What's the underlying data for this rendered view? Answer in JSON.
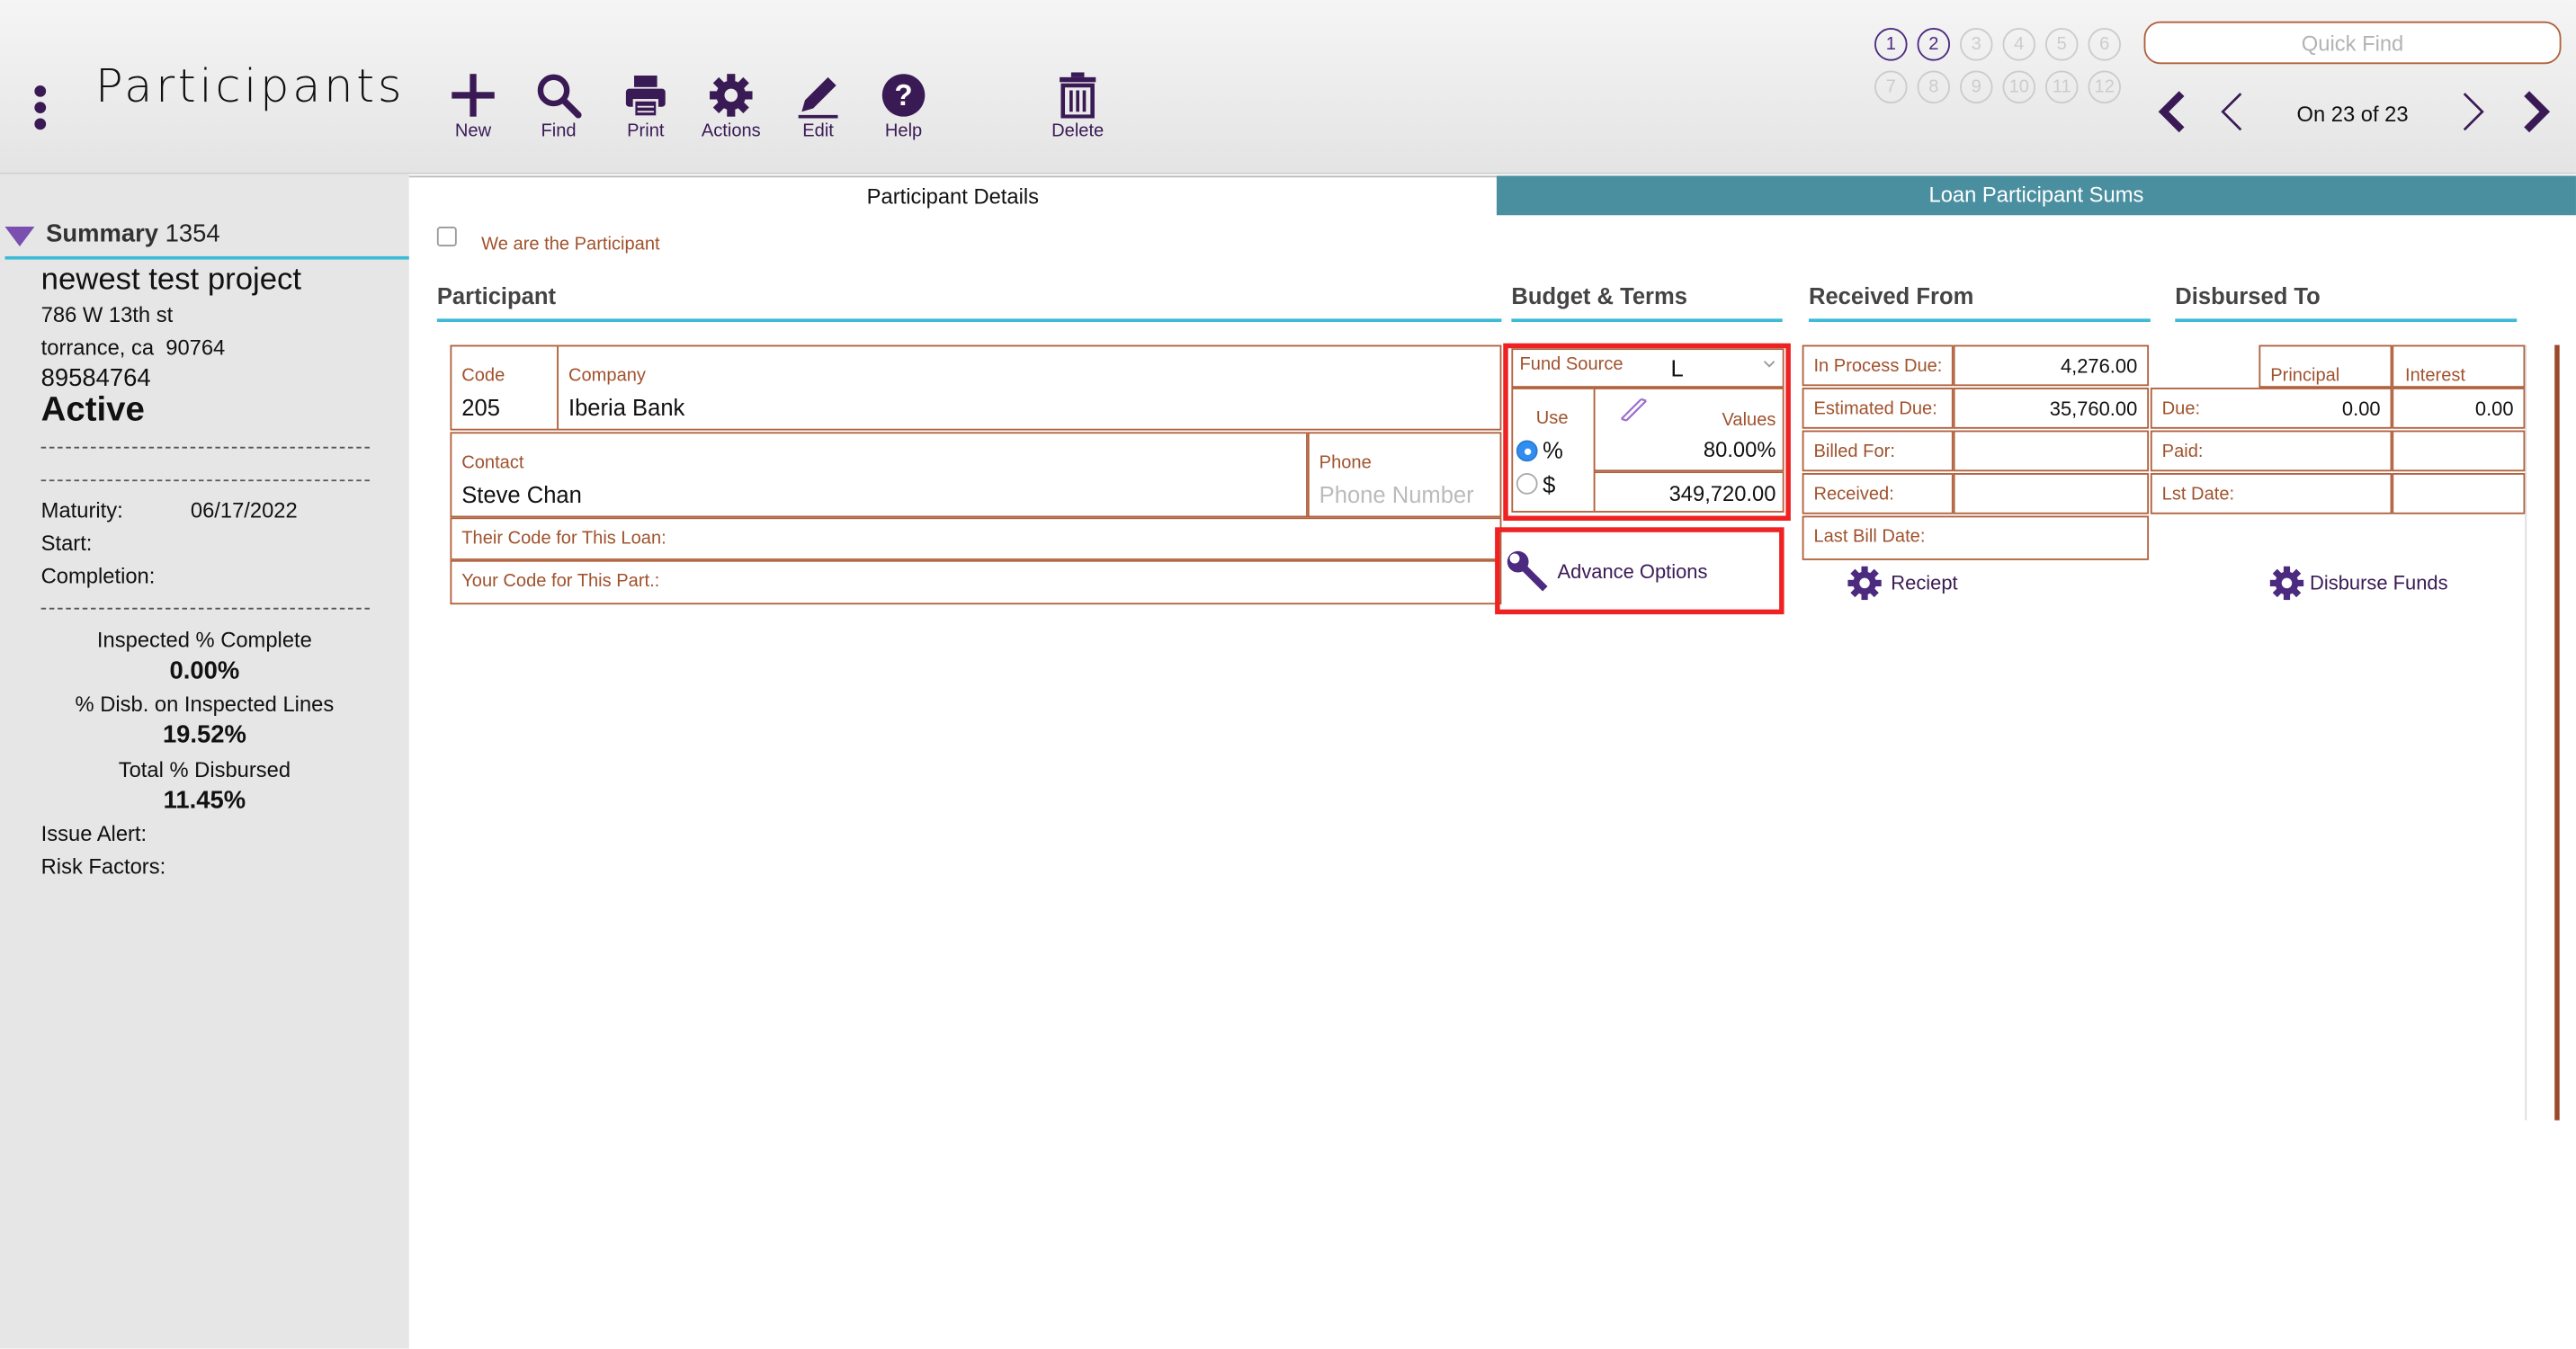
{
  "header": {
    "title": "Participants",
    "toolbar": [
      {
        "label": "New",
        "icon": "plus-icon"
      },
      {
        "label": "Find",
        "icon": "magnifier-icon"
      },
      {
        "label": "Print",
        "icon": "printer-icon"
      },
      {
        "label": "Actions",
        "icon": "gear-icon"
      },
      {
        "label": "Edit",
        "icon": "pencil-icon"
      },
      {
        "label": "Help",
        "icon": "help-icon"
      },
      {
        "label": "Delete",
        "icon": "trash-icon"
      }
    ],
    "record_slots": [
      "1",
      "2",
      "3",
      "4",
      "5",
      "6",
      "7",
      "8",
      "9",
      "10",
      "11",
      "12"
    ],
    "quick_find_placeholder": "Quick Find",
    "position_text": "On 23 of 23"
  },
  "sidebar": {
    "summary_label": "Summary",
    "summary_number": "1354",
    "project_name": "newest test project",
    "address1": "786 W 13th st",
    "address2": "torrance, ca  90764",
    "project_id": "89584764",
    "status": "Active",
    "maturity_label": "Maturity:",
    "maturity_value": "06/17/2022",
    "start_label": "Start:",
    "completion_label": "Completion:",
    "inspected_label": "Inspected % Complete",
    "inspected_value": "0.00%",
    "disb_inspected_label": "% Disb. on Inspected Lines",
    "disb_inspected_value": "19.52%",
    "total_disbursed_label": "Total % Disbursed",
    "total_disbursed_value": "11.45%",
    "issue_alert_label": "Issue Alert:",
    "risk_factors_label": "Risk Factors:"
  },
  "tabs": {
    "details": "Participant Details",
    "sums": "Loan Participant Sums"
  },
  "participant": {
    "we_are_label": "We are the Participant",
    "section_title": "Participant",
    "code_label": "Code",
    "code_value": "205",
    "company_label": "Company",
    "company_value": "Iberia Bank",
    "contact_label": "Contact",
    "contact_value": "Steve Chan",
    "phone_label": "Phone",
    "phone_placeholder": "Phone Number",
    "their_code_label": "Their Code for This Loan:",
    "your_code_label": "Your Code for This Part.:"
  },
  "budget": {
    "section_title": "Budget & Terms",
    "fund_source_label": "Fund Source",
    "fund_source_value": "L",
    "use_label": "Use",
    "values_label": "Values",
    "percent_symbol": "%",
    "dollar_symbol": "$",
    "percent_value": "80.00%",
    "dollar_value": "349,720.00",
    "advance_options_label": "Advance Options",
    "highlight_color": "#ee2222"
  },
  "received_from": {
    "section_title": "Received From",
    "rows": [
      {
        "label": "In Process Due:",
        "value": "4,276.00"
      },
      {
        "label": "Estimated Due:",
        "value": "35,760.00"
      },
      {
        "label": "Billed For:",
        "value": ""
      },
      {
        "label": "Received:",
        "value": ""
      },
      {
        "label": "Last Bill Date:",
        "value": ""
      }
    ],
    "receipt_label": "Reciept"
  },
  "disbursed_to": {
    "section_title": "Disbursed To",
    "principal_label": "Principal",
    "interest_label": "Interest",
    "rows": [
      {
        "label": "Due:",
        "principal": "0.00",
        "interest": "0.00"
      },
      {
        "label": "Paid:",
        "principal": "",
        "interest": ""
      },
      {
        "label": "Lst Date:",
        "principal": "",
        "interest": ""
      }
    ],
    "disburse_label": "Disburse Funds"
  },
  "colors": {
    "brand_purple": "#3a1a55",
    "field_border": "#b0603c",
    "accent_cyan": "#3dbbd6",
    "tab_teal": "#4a8fa0"
  }
}
